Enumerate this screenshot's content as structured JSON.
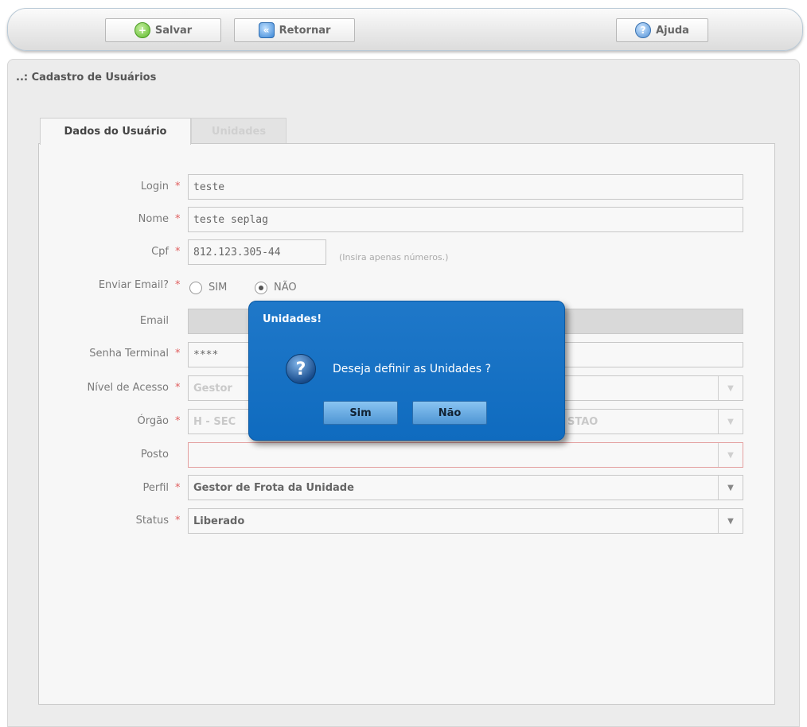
{
  "toolbar": {
    "save_label": "Salvar",
    "back_label": "Retornar",
    "help_label": "Ajuda"
  },
  "page": {
    "title": "..: Cadastro de Usuários"
  },
  "tabs": [
    {
      "label": "Dados do Usuário",
      "active": true
    },
    {
      "label": "Unidades",
      "active": false
    }
  ],
  "form": {
    "login": {
      "label": "Login",
      "value": "teste"
    },
    "nome": {
      "label": "Nome",
      "value": "teste seplag"
    },
    "cpf": {
      "label": "Cpf",
      "value": "812.123.305-44",
      "hint": "(Insira apenas números.)"
    },
    "enviar_email": {
      "label": "Enviar Email?",
      "options": [
        "SIM",
        "NÃO"
      ],
      "selected": "NÃO"
    },
    "email": {
      "label": "Email",
      "value": ""
    },
    "senha": {
      "label": "Senha Terminal",
      "value": "****"
    },
    "nivel": {
      "label": "Nível de Acesso",
      "value": "Gestor"
    },
    "orgao": {
      "label": "Órgão",
      "value": "H - SEC",
      "value_tail": "STAO"
    },
    "posto": {
      "label": "Posto",
      "value": ""
    },
    "perfil": {
      "label": "Perfil",
      "value": "Gestor de Frota da Unidade"
    },
    "status": {
      "label": "Status",
      "value": "Liberado"
    }
  },
  "dialog": {
    "title": "Unidades!",
    "message": "Deseja definir as Unidades ?",
    "yes_label": "Sim",
    "no_label": "Não",
    "icon": "question-icon"
  },
  "required_mark": "*",
  "dropdown_glyph": "▼",
  "colors": {
    "dialog_bg": "#1473c5",
    "required": "#e06060",
    "dialog_button": "#6aaee6"
  }
}
